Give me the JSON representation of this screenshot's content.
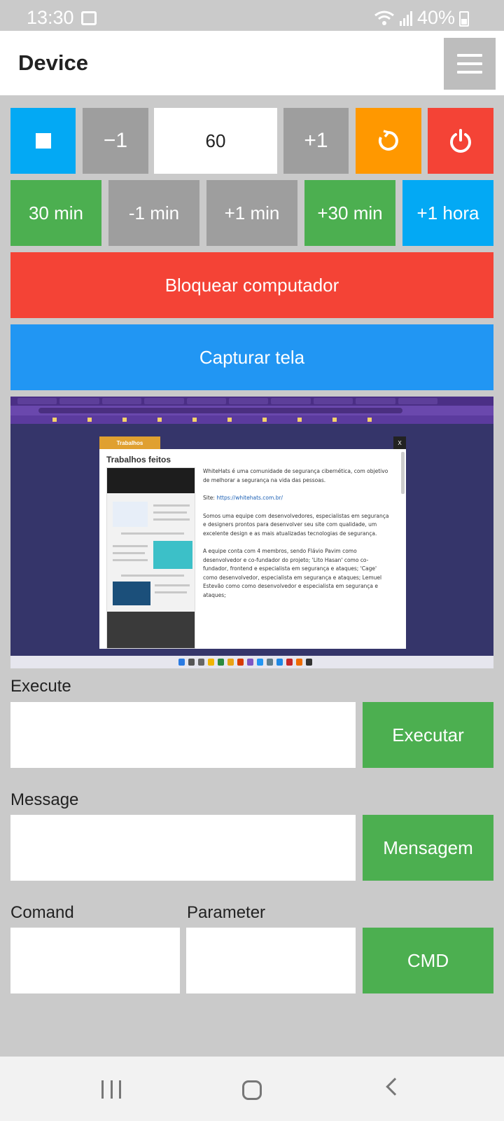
{
  "status_bar": {
    "time": "13:30",
    "battery": "40%"
  },
  "app_bar": {
    "title": "Device"
  },
  "controls": {
    "decrement_label": "−1",
    "value": "60",
    "increment_label": "+1"
  },
  "time_buttons": [
    "30 min",
    "-1 min",
    "+1 min",
    "+30 min",
    "+1 hora"
  ],
  "actions": {
    "lock_label": "Bloquear computador",
    "capture_label": "Capturar tela"
  },
  "screenshot": {
    "tab_label": "Trabalhos",
    "close_label": "X",
    "title": "Trabalhos feitos",
    "paragraphs": [
      "WhiteHats é uma comunidade de segurança cibernética, com objetivo de melhorar a segurança na vida das pessoas.",
      "Site: ",
      "Somos uma equipe com desenvolvedores, especialistas em segurança e designers prontos para desenvolver seu site com qualidade, um excelente design e as mais atualizadas tecnologias de segurança.",
      "A equipe conta com 4 membros, sendo Flávio Pavim como desenvolvedor e co-fundador do projeto; 'Lito Hasan' como co-fundador, frontend e especialista em segurança e ataques; 'Cage' como desenvolvedor, especialista em segurança e ataques; Lemuel Estevão como como desenvolvedor e especialista em segurança e ataques;"
    ],
    "site_link": "https://whitehats.com.br/"
  },
  "execute": {
    "label": "Execute",
    "button": "Executar"
  },
  "message": {
    "label": "Message",
    "button": "Mensagem"
  },
  "command": {
    "label": "Comand",
    "parameter_label": "Parameter",
    "button": "CMD"
  },
  "colors": {
    "blue": "#03a9f4",
    "grey": "#9e9e9e",
    "orange": "#ff9800",
    "red": "#f44336",
    "green": "#4caf50",
    "capture_blue": "#2196f3",
    "background": "#cacaca"
  }
}
